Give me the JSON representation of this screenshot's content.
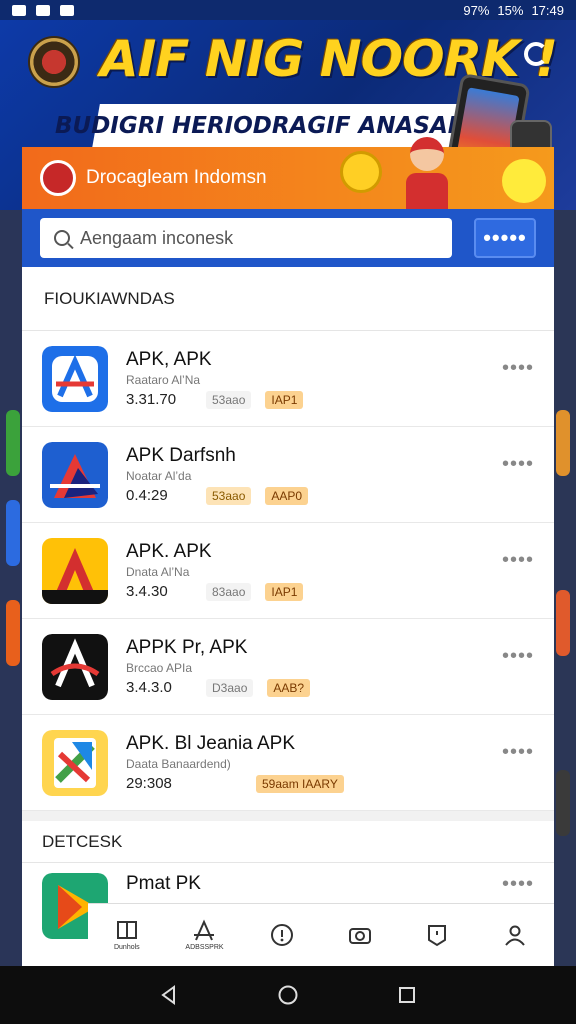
{
  "status_bar": {
    "battery": "97%",
    "signal_text": "15%",
    "time": "17:49"
  },
  "hero": {
    "title": "AIF NIG NOORK !",
    "subtitle": "BUDIGRI HERIODRAGIF ANASAIHNTA"
  },
  "promo": {
    "label": "Drocagleam Indomsn",
    "sticker": ""
  },
  "search": {
    "placeholder": "Aengaam inconesk",
    "more": "•••••"
  },
  "section_top": "FIOUKIAWNDAS",
  "apps": [
    {
      "name": "APK, APK",
      "developer": "Raataro Al’Na",
      "version": "3.31.70",
      "size": "53aao",
      "badge": "IAP1",
      "size_highlight": false
    },
    {
      "name": "APK Darfsnh",
      "developer": "Noatar Al’da",
      "version": "0.4:29",
      "size": "53aao",
      "badge": "AAP0",
      "size_highlight": true
    },
    {
      "name": "APK. APK",
      "developer": "Dnata Al’Na",
      "version": "3.4.30",
      "size": "83aao",
      "badge": "IAP1",
      "size_highlight": false
    },
    {
      "name": "APPK Pr, APK",
      "developer": "Brccao APIa",
      "version": "3.4.3.0",
      "size": "D3aao",
      "badge": "AAB?",
      "size_highlight": false
    },
    {
      "name": "APK. Bl Jeania APK",
      "developer": "Daata Banaardend)",
      "version": "29:308",
      "size": "",
      "badge": "59aam IAARY",
      "size_highlight": false
    }
  ],
  "section_bottom": "DETCESK",
  "last_app": {
    "name": "Pmat PK"
  },
  "nav": [
    {
      "icon": "book-icon",
      "label": "Dunhols"
    },
    {
      "icon": "apk-icon",
      "label": "ADBSSPRK"
    },
    {
      "icon": "info-icon",
      "label": ""
    },
    {
      "icon": "camera-icon",
      "label": ""
    },
    {
      "icon": "badge-icon",
      "label": ""
    },
    {
      "icon": "profile-icon",
      "label": ""
    }
  ]
}
